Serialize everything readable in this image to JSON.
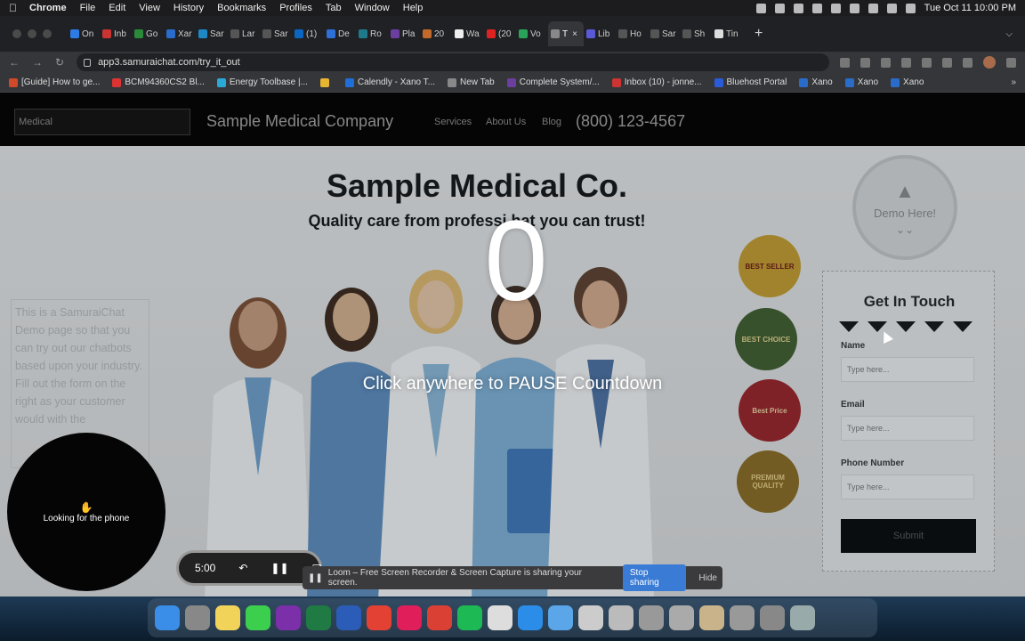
{
  "menubar": {
    "app": "Chrome",
    "items": [
      "File",
      "Edit",
      "View",
      "History",
      "Bookmarks",
      "Profiles",
      "Tab",
      "Window",
      "Help"
    ],
    "clock": "Tue Oct 11  10:00 PM"
  },
  "tabs": [
    {
      "label": "On",
      "color": "#2d7be5"
    },
    {
      "label": "Inb",
      "color": "#cc3333"
    },
    {
      "label": "Go",
      "color": "#2a8a3a"
    },
    {
      "label": "Xar",
      "color": "#2a6cc9"
    },
    {
      "label": "Sar",
      "color": "#1e88c7"
    },
    {
      "label": "Lar",
      "color": "#555"
    },
    {
      "label": "Sar",
      "color": "#555"
    },
    {
      "label": "(1)",
      "color": "#0a66c2"
    },
    {
      "label": "De",
      "color": "#2f6fd8"
    },
    {
      "label": "Ro",
      "color": "#1e7a8a"
    },
    {
      "label": "Pla",
      "color": "#6b3fa0"
    },
    {
      "label": "20",
      "color": "#c26a2b"
    },
    {
      "label": "Wa",
      "color": "#eee"
    },
    {
      "label": "(20",
      "color": "#d22"
    },
    {
      "label": "Vo",
      "color": "#2aa35a"
    },
    {
      "label": "T",
      "color": "#888"
    },
    {
      "label": "Lib",
      "color": "#5a5ad8"
    },
    {
      "label": "Ho",
      "color": "#555"
    },
    {
      "label": "Sar",
      "color": "#555"
    },
    {
      "label": "Sh",
      "color": "#555"
    },
    {
      "label": "Tin",
      "color": "#ddd"
    }
  ],
  "address": {
    "url": "app3.samuraichat.com/try_it_out"
  },
  "bookmarks": [
    {
      "label": "[Guide] How to ge...",
      "color": "#d04a2a"
    },
    {
      "label": "BCM94360CS2 Bl...",
      "color": "#d33"
    },
    {
      "label": "Energy Toolbase |...",
      "color": "#2aa8d8"
    },
    {
      "label": "",
      "color": "#e8b533"
    },
    {
      "label": "Calendly - Xano T...",
      "color": "#1e6fd9"
    },
    {
      "label": "New Tab",
      "color": "#888"
    },
    {
      "label": "Complete System/...",
      "color": "#6b3fa0"
    },
    {
      "label": "Inbox (10) - jonne...",
      "color": "#cc3333"
    },
    {
      "label": "Bluehost Portal",
      "color": "#2a5bd9"
    },
    {
      "label": "Xano",
      "color": "#2a6cc9"
    },
    {
      "label": "Xano",
      "color": "#2a6cc9"
    },
    {
      "label": "Xano",
      "color": "#2a6cc9"
    }
  ],
  "site": {
    "industry_select": "Medical",
    "name": "Sample Medical Company",
    "nav": [
      "Services",
      "About Us",
      "Blog"
    ],
    "phone": "(800) 123-4567",
    "hero_title": "Sample Medical Co.",
    "hero_sub": "Quality care from professi        hat you can trust!",
    "side_text": "This is a SamuraiChat Demo page so that you can try out our chatbots based upon your industry. Fill out the form on the right as your customer would        with the",
    "demo_here": "Demo Here!",
    "badges": [
      "BEST SELLER",
      "BEST CHOICE",
      "Best Price",
      "PREMIUM QUALITY"
    ],
    "form": {
      "title": "Get In Touch",
      "name_label": "Name",
      "name_placeholder": "Type here...",
      "email_label": "Email",
      "email_placeholder": "Type here...",
      "phone_label": "Phone Number",
      "phone_placeholder": "Type here...",
      "submit": "Submit"
    }
  },
  "overlay": {
    "countdown": "0",
    "hint": "Click anywhere to PAUSE Countdown",
    "bubble_text": "Looking for the phone"
  },
  "loom": {
    "timer": "5:00",
    "share_text": "Loom – Free Screen Recorder & Screen Capture is sharing your screen.",
    "stop": "Stop sharing",
    "hide": "Hide"
  },
  "dock": {
    "icons": [
      {
        "name": "finder-icon",
        "color": "#3b8ee8"
      },
      {
        "name": "launchpad-icon",
        "color": "#888"
      },
      {
        "name": "notes-icon",
        "color": "#f2d35a"
      },
      {
        "name": "messages-icon",
        "color": "#3ccf4e"
      },
      {
        "name": "onenote-icon",
        "color": "#7b2fa8"
      },
      {
        "name": "excel-icon",
        "color": "#1f7a44"
      },
      {
        "name": "word-icon",
        "color": "#2b5db8"
      },
      {
        "name": "chrome-icon",
        "color": "#e34133"
      },
      {
        "name": "slack-icon",
        "color": "#e01e5a"
      },
      {
        "name": "todoist-icon",
        "color": "#db4035"
      },
      {
        "name": "spotify-icon",
        "color": "#1db954"
      },
      {
        "name": "loom-icon",
        "color": "#ddd"
      },
      {
        "name": "appstore-icon",
        "color": "#2b8de8"
      },
      {
        "name": "folder-icon",
        "color": "#5aa6e8"
      },
      {
        "name": "window-icon",
        "color": "#ccc"
      },
      {
        "name": "window-icon",
        "color": "#bbb"
      },
      {
        "name": "window-icon",
        "color": "#999"
      },
      {
        "name": "window-icon",
        "color": "#aaa"
      },
      {
        "name": "window-icon",
        "color": "#c9b38a"
      },
      {
        "name": "window-icon",
        "color": "#999"
      },
      {
        "name": "window-icon",
        "color": "#888"
      },
      {
        "name": "trash-icon",
        "color": "#9aa"
      }
    ]
  }
}
